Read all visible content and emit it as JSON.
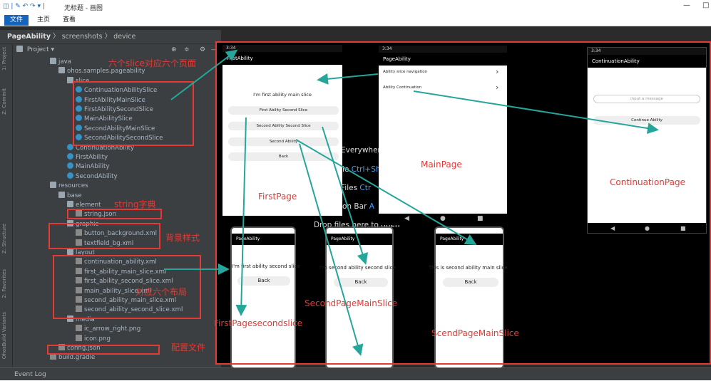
{
  "window": {
    "title": "无标题 - 画图",
    "quick_icons": "◫ | ✎ ↶ ↷ ▾ |"
  },
  "ribbon": {
    "tabs": [
      "文件",
      "主页",
      "查看"
    ]
  },
  "breadcrumb": {
    "items": [
      "PageAbility",
      "screenshots",
      "device"
    ]
  },
  "left_toolbar": {
    "tabs": [
      "1: Project",
      "Z: Commit",
      "Z: Structure",
      "2: Favorites",
      "OhosBuild Variants"
    ]
  },
  "project_panel": {
    "label": "Project"
  },
  "tree": [
    {
      "label": "java",
      "depth": 3,
      "icon": "folder"
    },
    {
      "label": "ohos.samples.pageability",
      "depth": 4,
      "icon": "folder"
    },
    {
      "label": "slice",
      "depth": 5,
      "icon": "folder"
    },
    {
      "label": "ContinuationAbilitySlice",
      "depth": 6,
      "icon": "class"
    },
    {
      "label": "FirstAbilityMainSlice",
      "depth": 6,
      "icon": "class"
    },
    {
      "label": "FirstAbilitySecondSlice",
      "depth": 6,
      "icon": "class"
    },
    {
      "label": "MainAbilitySlice",
      "depth": 6,
      "icon": "class"
    },
    {
      "label": "SecondAbilityMainSlice",
      "depth": 6,
      "icon": "class"
    },
    {
      "label": "SecondAbilitySecondSlice",
      "depth": 6,
      "icon": "class"
    },
    {
      "label": "ContinuationAbility",
      "depth": 5,
      "icon": "class"
    },
    {
      "label": "FirstAbility",
      "depth": 5,
      "icon": "class"
    },
    {
      "label": "MainAbility",
      "depth": 5,
      "icon": "class"
    },
    {
      "label": "SecondAbility",
      "depth": 5,
      "icon": "class"
    },
    {
      "label": "resources",
      "depth": 3,
      "icon": "folder"
    },
    {
      "label": "base",
      "depth": 4,
      "icon": "folder"
    },
    {
      "label": "element",
      "depth": 5,
      "icon": "folder"
    },
    {
      "label": "string.json",
      "depth": 6,
      "icon": "file"
    },
    {
      "label": "graphic",
      "depth": 5,
      "icon": "folder"
    },
    {
      "label": "button_background.xml",
      "depth": 6,
      "icon": "file"
    },
    {
      "label": "textfield_bg.xml",
      "depth": 6,
      "icon": "file"
    },
    {
      "label": "layout",
      "depth": 5,
      "icon": "folder"
    },
    {
      "label": "continuation_ability.xml",
      "depth": 6,
      "icon": "file"
    },
    {
      "label": "first_ability_main_slice.xml",
      "depth": 6,
      "icon": "file"
    },
    {
      "label": "first_ability_second_slice.xml",
      "depth": 6,
      "icon": "file"
    },
    {
      "label": "main_ability_slice.xml",
      "depth": 6,
      "icon": "file"
    },
    {
      "label": "second_ability_main_slice.xml",
      "depth": 6,
      "icon": "file"
    },
    {
      "label": "second_ability_second_slice.xml",
      "depth": 6,
      "icon": "file"
    },
    {
      "label": "media",
      "depth": 5,
      "icon": "folder"
    },
    {
      "label": "ic_arrow_right.png",
      "depth": 6,
      "icon": "file"
    },
    {
      "label": "icon.png",
      "depth": 6,
      "icon": "file"
    },
    {
      "label": "config.json",
      "depth": 4,
      "icon": "file"
    },
    {
      "label": "build.gradle",
      "depth": 3,
      "icon": "file"
    }
  ],
  "annotations": {
    "slices": "六个slice对应六个页面",
    "strings": "string字典",
    "background": "背景样式",
    "layouts": "对应六个布局",
    "config": "配置文件"
  },
  "editor_hints": {
    "everywhere": "Everywher",
    "file_prefix": "le",
    "file_key": "Ctrl+Sh",
    "files_prefix": "Files",
    "files_key": "Ctr",
    "navbar_prefix": "on Bar",
    "navbar_key": "A",
    "drop": "Drop files here to open"
  },
  "first_page": {
    "time": "3:34",
    "title": "FirstAbility",
    "heading": "I'm first ability main slice",
    "buttons": [
      "First Ability Second Slice",
      "Second Ability Second Slice",
      "Second Ability",
      "Back"
    ],
    "label": "FirstPage"
  },
  "main_page": {
    "time": "3:34",
    "title": "PageAbility",
    "items": [
      "Ability slice navigation",
      "Ability Continuation"
    ],
    "label": "MainPage"
  },
  "continuation_page": {
    "time": "3:34",
    "title": "ContinuationAbility",
    "input_placeholder": "input a message",
    "button": "Continue Ability",
    "label": "ContinuationPage"
  },
  "first_second_page": {
    "title": "PageAbility",
    "heading": "I'm first ability second slice",
    "button": "Back",
    "label": "FirstPagesecondslice"
  },
  "second_main_page": {
    "title": "PageAbility",
    "heading": "I'm second ability second slice",
    "button": "Back",
    "label": "SecondPageMainSlice"
  },
  "second_second_page": {
    "title": "PageAbility",
    "heading": "This is second ability main slice",
    "button": "Back",
    "label": "ScendPageMainSlice"
  },
  "event_log": "Event Log",
  "colors": {
    "annotation": "#e53935",
    "arrow": "#26a69a",
    "ide_bg": "#3c3f41"
  }
}
